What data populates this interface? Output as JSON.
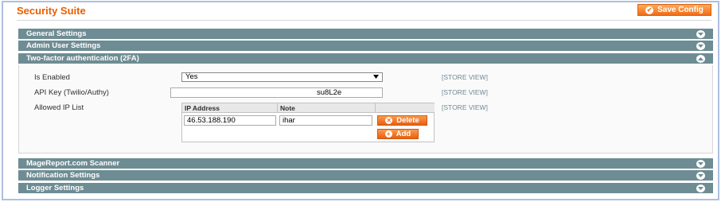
{
  "page": {
    "title": "Security Suite",
    "save_label": "Save Config"
  },
  "sections": {
    "general": "General Settings",
    "admin_user": "Admin User Settings",
    "two_factor": "Two-factor authentication (2FA)",
    "magereport": "MageReport.com Scanner",
    "notification": "Notification Settings",
    "logger": "Logger Settings"
  },
  "two_factor": {
    "is_enabled_label": "Is Enabled",
    "is_enabled_value": "Yes",
    "api_key_label": "API Key (Twilio/Authy)",
    "api_key_value": "su8L2e",
    "allowed_ip_label": "Allowed IP List",
    "scope_label": "[STORE VIEW]",
    "ip_table": {
      "col_ip": "IP Address",
      "col_note": "Note",
      "rows": [
        {
          "ip": "46.53.188.190",
          "note": "ihar"
        }
      ],
      "delete_label": "Delete",
      "add_label": "Add"
    }
  },
  "colors": {
    "accent": "#eb5e00",
    "section_header": "#6e8c93",
    "button_orange": "#f26c17"
  }
}
